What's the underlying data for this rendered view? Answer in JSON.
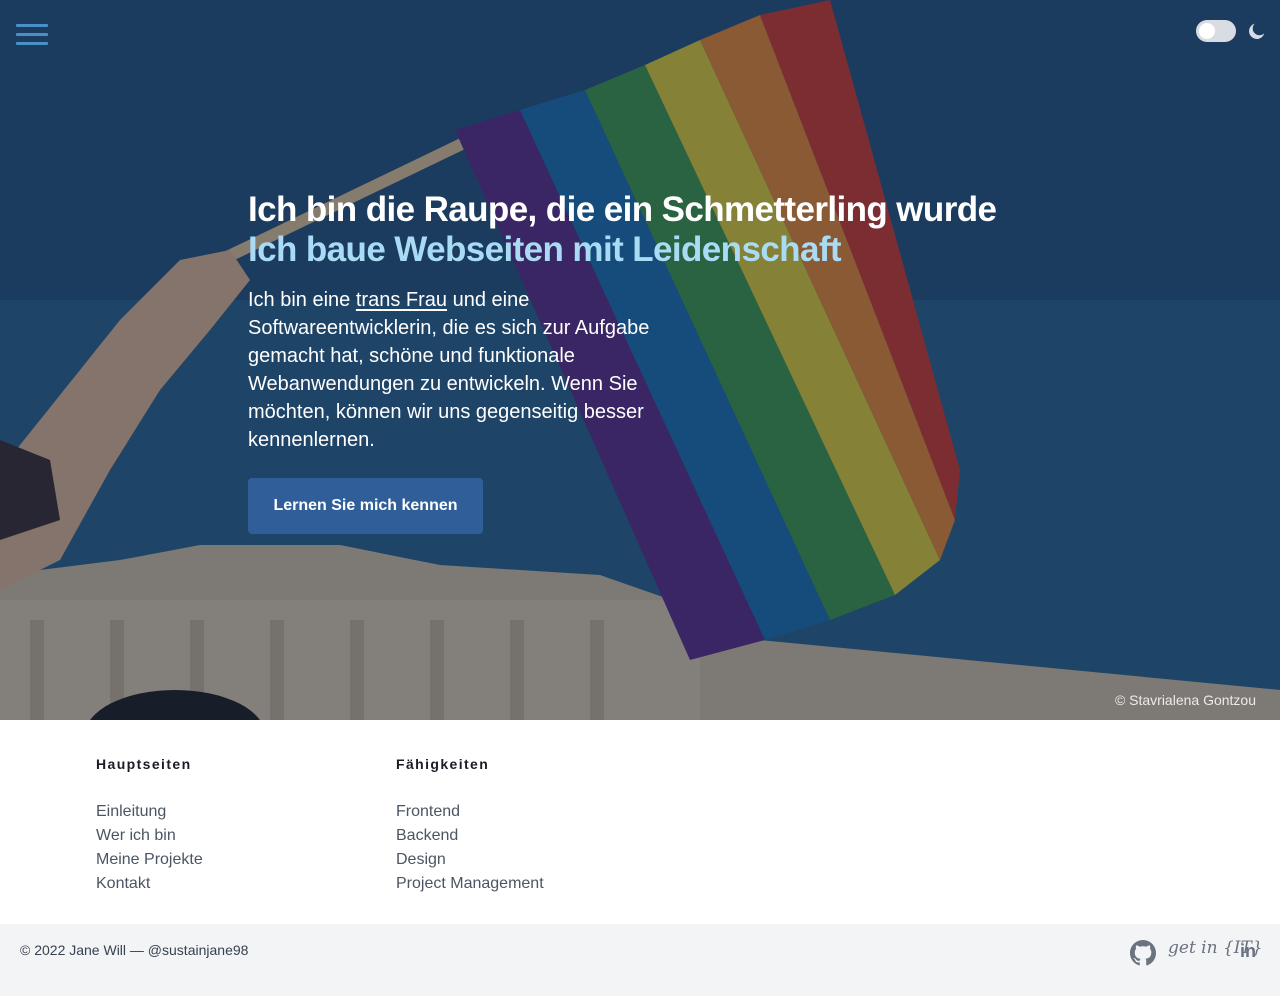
{
  "header": {
    "menu_icon": "hamburger-menu-icon",
    "theme_toggle_state": "off",
    "theme_icon": "moon-icon"
  },
  "hero": {
    "title": "Ich bin die Raupe, die ein Schmetterling wurde",
    "subtitle": "Ich baue Webseiten mit Leidenschaft",
    "text_before_link": "Ich bin eine ",
    "link_text": "trans Frau",
    "text_after_link": " und eine Softwareentwicklerin, die es sich zur Aufgabe gemacht hat, schöne und funktionale Webanwendungen zu entwickeln. Wenn Sie möchten, können wir uns gegenseitig besser kennenlernen.",
    "cta_label": "Lernen Sie mich kennen",
    "photo_credit": "© Stavrialena Gontzou",
    "colors": {
      "title": "#ffffff",
      "subtitle": "#a9dcf4",
      "cta": "#2f5e99"
    }
  },
  "footer": {
    "columns": [
      {
        "heading": "Hauptseiten",
        "items": [
          "Einleitung",
          "Wer ich bin",
          "Meine Projekte",
          "Kontakt"
        ]
      },
      {
        "heading": "Fähigkeiten",
        "items": [
          "Frontend",
          "Backend",
          "Design",
          "Project Management"
        ]
      }
    ],
    "copyright": "© 2022 Jane Will — @sustainjane98",
    "social": {
      "github_icon": "github-icon",
      "getinit_label": "get in {IT}",
      "linkedin_label": "in"
    }
  }
}
